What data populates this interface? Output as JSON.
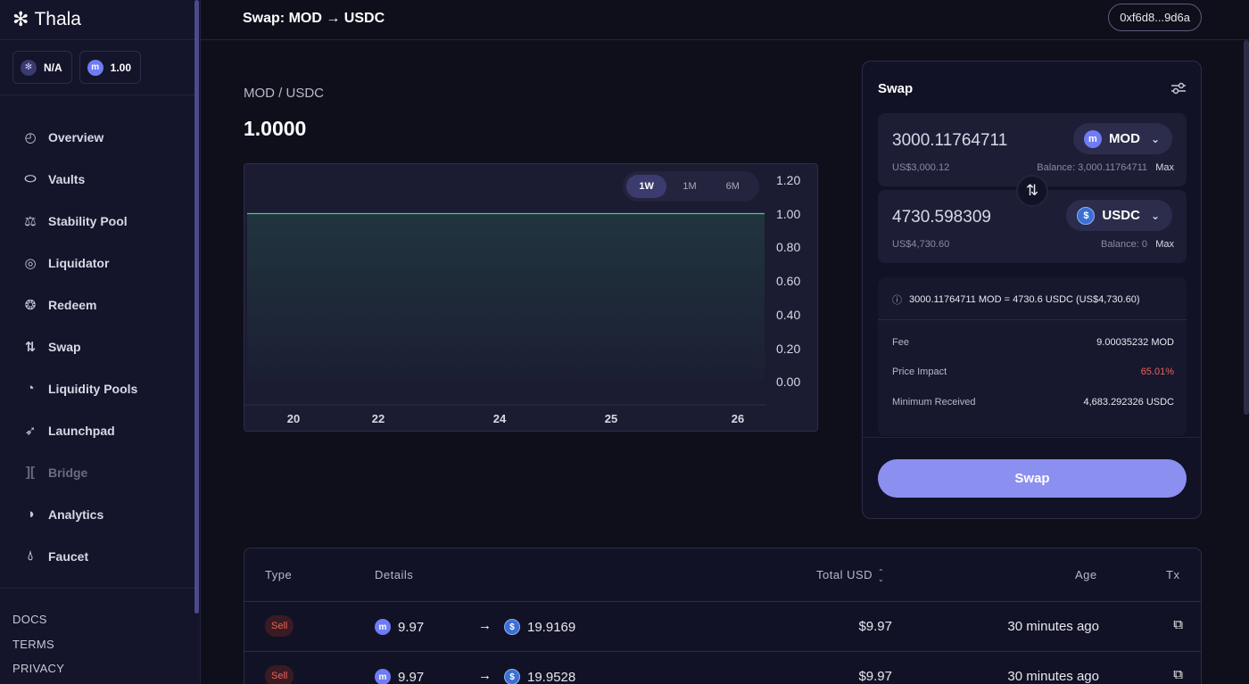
{
  "sidebar": {
    "logo": "Thala",
    "badges": [
      {
        "label": "N/A",
        "icon": "thala-token-icon"
      },
      {
        "label": "1.00",
        "icon": "mod-token-icon"
      }
    ],
    "nav": [
      {
        "label": "Overview",
        "icon": "overview-icon",
        "disabled": false
      },
      {
        "label": "Vaults",
        "icon": "vault-icon",
        "disabled": false
      },
      {
        "label": "Stability Pool",
        "icon": "stability-pool-icon",
        "disabled": false
      },
      {
        "label": "Liquidator",
        "icon": "liquidator-icon",
        "disabled": false
      },
      {
        "label": "Redeem",
        "icon": "redeem-icon",
        "disabled": false
      },
      {
        "label": "Swap",
        "icon": "swap-icon",
        "disabled": false
      },
      {
        "label": "Liquidity Pools",
        "icon": "liquidity-pools-icon",
        "disabled": false
      },
      {
        "label": "Launchpad",
        "icon": "rocket-icon",
        "disabled": false
      },
      {
        "label": "Bridge",
        "icon": "bridge-icon",
        "disabled": true
      },
      {
        "label": "Analytics",
        "icon": "analytics-icon",
        "disabled": false
      },
      {
        "label": "Faucet",
        "icon": "drop-icon",
        "disabled": false
      }
    ],
    "footer": [
      "DOCS",
      "TERMS",
      "PRIVACY"
    ]
  },
  "header": {
    "title": "Swap: MOD → USDC",
    "wallet": "0xf6d8...9d6a"
  },
  "pair": {
    "label": "MOD / USDC",
    "price": "1.0000"
  },
  "chart_data": {
    "type": "area",
    "x_ticks": [
      "20",
      "22",
      "24",
      "25",
      "26"
    ],
    "y_ticks": [
      "1.20",
      "1.00",
      "0.80",
      "0.60",
      "0.40",
      "0.20",
      "0.00"
    ],
    "ylim": [
      0,
      1.2
    ],
    "series": [
      {
        "values": [
          1.0,
          1.0,
          1.0,
          1.0,
          1.0,
          1.0
        ],
        "color": "#3fcf8e"
      }
    ],
    "timeframes": [
      "1W",
      "1M",
      "6M"
    ],
    "active_timeframe": "1W"
  },
  "swap": {
    "title": "Swap",
    "from": {
      "amount": "3000.11764711",
      "usd": "US$3,000.12",
      "balance": "Balance: 3,000.11764711",
      "max": "Max",
      "token": "MOD"
    },
    "to": {
      "amount": "4730.598309",
      "usd": "US$4,730.60",
      "balance": "Balance: 0",
      "max": "Max",
      "token": "USDC"
    },
    "quote": "3000.11764711 MOD = 4730.6 USDC (US$4,730.60)",
    "details": [
      {
        "label": "Fee",
        "value": "9.00035232 MOD"
      },
      {
        "label": "Price Impact",
        "value": "65.01%"
      },
      {
        "label": "Minimum Received",
        "value": "4,683.292326 USDC"
      }
    ],
    "button": "Swap"
  },
  "table": {
    "headers": {
      "type": "Type",
      "details": "Details",
      "total": "Total USD",
      "age": "Age",
      "tx": "Tx"
    },
    "rows": [
      {
        "type": "Sell",
        "from_amount": "9.97",
        "to_amount": "19.9169",
        "total": "$9.97",
        "age": "30 minutes ago"
      },
      {
        "type": "Sell",
        "from_amount": "9.97",
        "to_amount": "19.9528",
        "total": "$9.97",
        "age": "30 minutes ago"
      }
    ]
  },
  "colors": {
    "accent": "#8b8ff0",
    "negative": "#e8645a",
    "line": "#3fcf8e"
  }
}
